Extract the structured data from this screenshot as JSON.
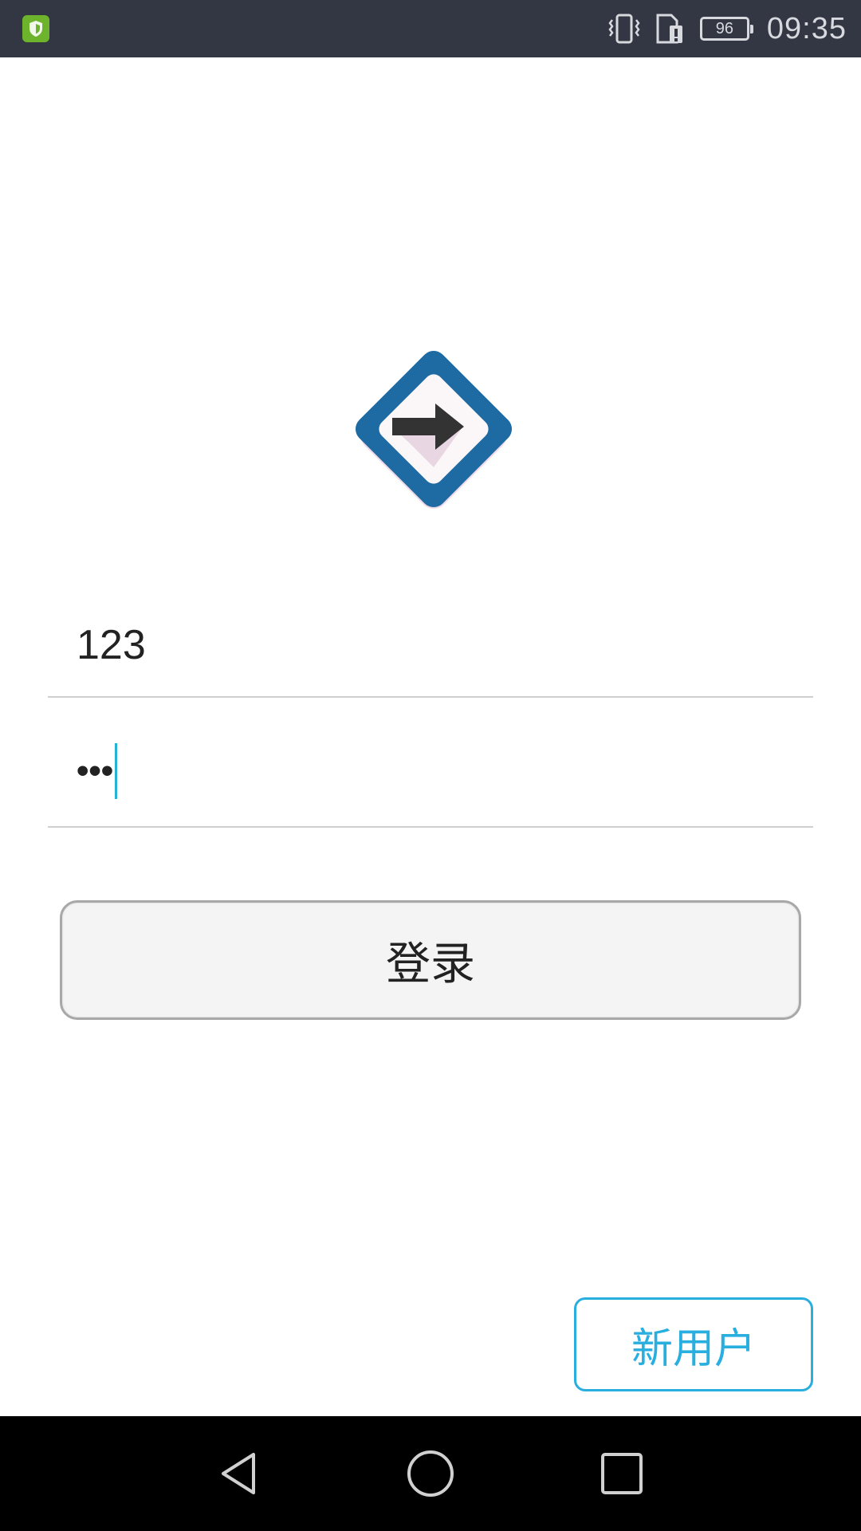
{
  "status_bar": {
    "app_icon": "shield-app-icon",
    "icons": [
      "vibrate-icon",
      "sim-card-icon"
    ],
    "battery_level": "96",
    "time": "09:35",
    "background_color": "#333743"
  },
  "logo": {
    "icon": "arrow-right-diamond-logo",
    "frame_color": "#1e6aa3",
    "arrow_color": "#333333"
  },
  "login_form": {
    "username_value": "123",
    "password_mask": "•••",
    "caret_color": "#25b3d5",
    "login_button_label": "登录"
  },
  "footer": {
    "new_user_label": "新用户",
    "accent_color": "#29aee0"
  },
  "nav_bar": {
    "buttons": [
      "back-icon",
      "home-icon",
      "recent-apps-icon"
    ]
  }
}
